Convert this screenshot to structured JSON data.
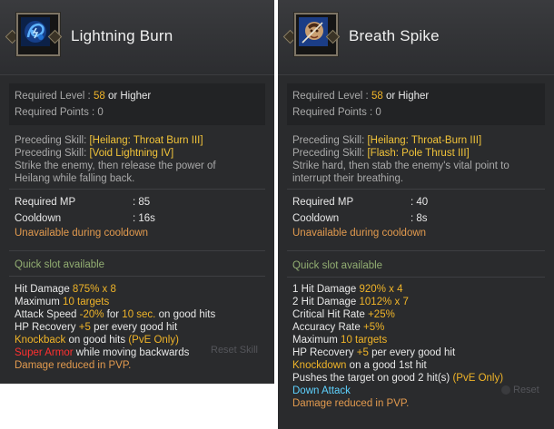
{
  "left": {
    "title": "Lightning Burn",
    "req_level_label": "Required Level :",
    "req_level_value": "58",
    "req_level_suffix": "or Higher",
    "req_points": "Required Points : 0",
    "preceding_label": "Preceding Skill:",
    "preceding1": "[Heilang: Throat Burn III]",
    "preceding2": "[Void Lightning IV]",
    "desc1": "Strike the enemy, then release the power of",
    "desc2": "Heilang while falling back.",
    "mp_label": "Required MP",
    "mp_value": ": 85",
    "cd_label": "Cooldown",
    "cd_value": ": 16s",
    "unavailable": "Unavailable during cooldown",
    "quick_slot": "Quick slot available",
    "hit_damage_label": "Hit Damage",
    "hit_damage_value": "875% x 8",
    "max_label": "Maximum",
    "max_value": "10 targets",
    "atk_speed_label": "Attack Speed",
    "atk_speed_value": "-20%",
    "atk_for": "for",
    "atk_duration": "10 sec.",
    "atk_suffix": "on good hits",
    "hp_label": "HP Recovery",
    "hp_value": "+5",
    "hp_suffix": "per every good hit",
    "knockback": "Knockback",
    "knockback_suffix": "on good hits",
    "pve_only": "(PvE Only)",
    "super_armor": "Super Armor",
    "super_armor_suffix": "while moving backwards",
    "damage_reduced": "Damage reduced in PVP."
  },
  "right": {
    "title": "Breath Spike",
    "req_level_label": "Required Level :",
    "req_level_value": "58",
    "req_level_suffix": "or Higher",
    "req_points": "Required Points : 0",
    "preceding_label": "Preceding Skill:",
    "preceding1": "[Heilang: Throat-Burn III]",
    "preceding2": "[Flash: Pole Thrust III]",
    "desc1": "Strike hard, then stab the enemy's vital point to",
    "desc2": "interrupt their breathing.",
    "mp_label": "Required MP",
    "mp_value": ": 40",
    "cd_label": "Cooldown",
    "cd_value": ": 8s",
    "unavailable": "Unavailable during cooldown",
    "quick_slot": "Quick slot available",
    "hit1_label": "1 Hit Damage",
    "hit1_value": "920% x 4",
    "hit2_label": "2 Hit Damage",
    "hit2_value": "1012% x 7",
    "crit_label": "Critical Hit Rate",
    "crit_value": "+25%",
    "acc_label": "Accuracy Rate",
    "acc_value": "+5%",
    "max_label": "Maximum",
    "max_value": "10 targets",
    "hp_label": "HP Recovery",
    "hp_value": "+5",
    "hp_suffix": "per every good hit",
    "knockdown": "Knockdown",
    "knockdown_suffix": "on a good 1st hit",
    "pushes": "Pushes the target on good 2 hit(s)",
    "pve_only": "(PvE Only)",
    "down_attack": "Down Attack",
    "damage_reduced": "Damage reduced in PVP."
  },
  "background": {
    "reset_left": "Reset Skill",
    "reset_right": "Reset"
  },
  "colors": {
    "panel_bg": "#2a2b2d",
    "gold": "#f0b428",
    "orange": "#e29a4e",
    "red": "#ff3030",
    "cyan": "#5ed2ff",
    "green": "#92ae72"
  },
  "icons": {
    "left_skill": "lightning-burn-skill-icon",
    "right_skill": "breath-spike-skill-icon"
  }
}
